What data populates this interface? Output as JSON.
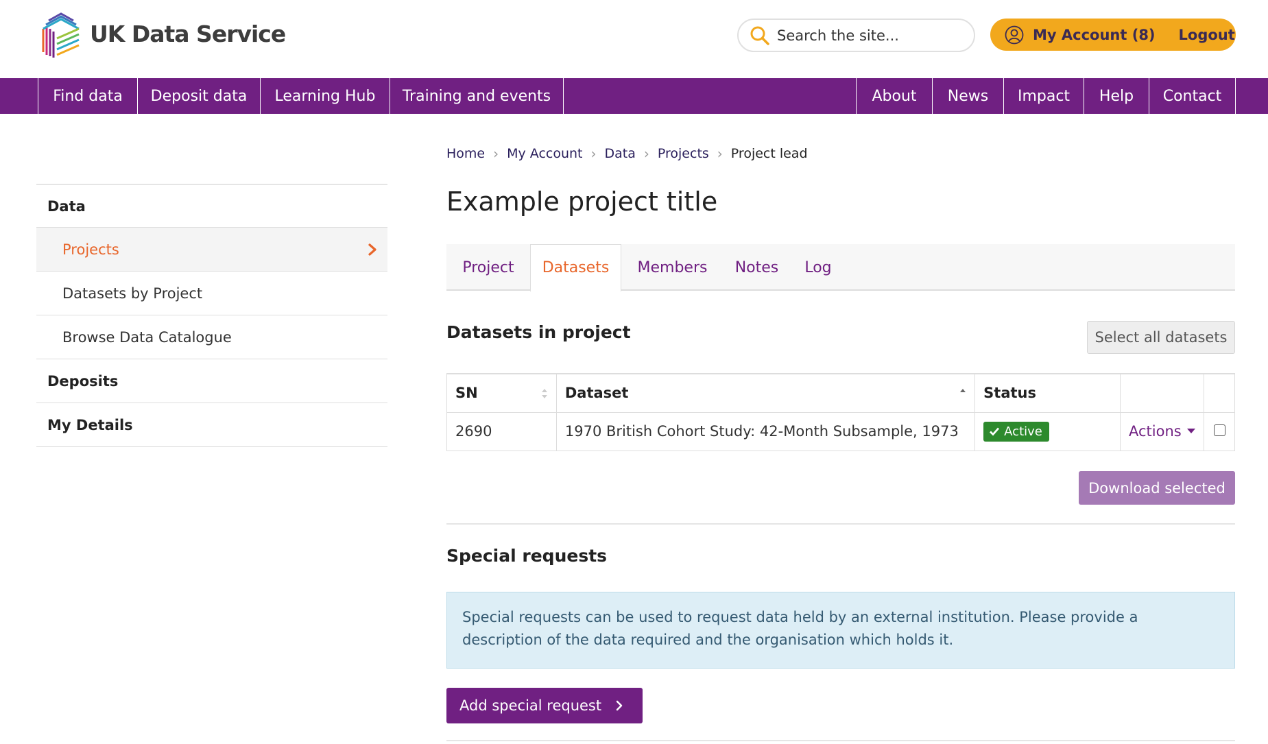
{
  "header": {
    "logo_text": "UK Data Service",
    "search_placeholder": "Search the site...",
    "account_label": "My Account (8)",
    "logout_label": "Logout"
  },
  "nav": {
    "left": [
      "Find data",
      "Deposit data",
      "Learning Hub",
      "Training and events"
    ],
    "right": [
      "About",
      "News",
      "Impact",
      "Help",
      "Contact"
    ]
  },
  "sidebar": {
    "data_heading": "Data",
    "items": [
      "Projects",
      "Datasets by Project",
      "Browse Data Catalogue"
    ],
    "deposits_heading": "Deposits",
    "details_heading": "My Details"
  },
  "breadcrumb": [
    "Home",
    "My Account",
    "Data",
    "Projects",
    "Project lead"
  ],
  "page_title": "Example project title",
  "tabs": [
    "Project",
    "Datasets",
    "Members",
    "Notes",
    "Log"
  ],
  "datasets": {
    "heading": "Datasets in project",
    "select_all_label": "Select all datasets",
    "columns": [
      "SN",
      "Dataset",
      "Status"
    ],
    "rows": [
      {
        "sn": "2690",
        "dataset": "1970 British Cohort Study: 42-Month Subsample, 1973",
        "status": "Active",
        "actions": "Actions"
      }
    ],
    "download_label": "Download selected"
  },
  "special_requests": {
    "heading": "Special requests",
    "info": "Special requests can be used to request data held by an external institution. Please provide a description of the data required and the organisation which holds it.",
    "add_label": "Add special request"
  },
  "colors": {
    "brand_purple": "#702082",
    "accent_orange": "#e8662b",
    "account_yellow": "#f2a81d",
    "status_green": "#2d8a2d"
  }
}
